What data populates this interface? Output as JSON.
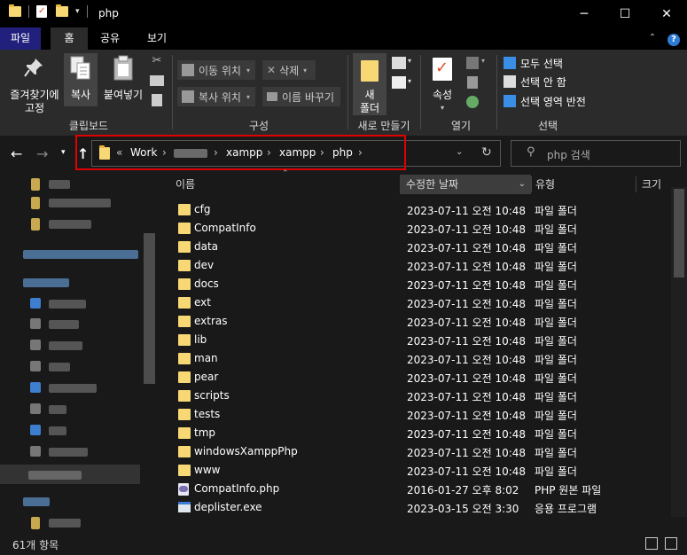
{
  "window": {
    "title": "php",
    "minimize_glyph": "─",
    "maximize_glyph": "☐",
    "close_glyph": "✕"
  },
  "tabs": [
    {
      "label": "파일"
    },
    {
      "label": "홈"
    },
    {
      "label": "공유"
    },
    {
      "label": "보기"
    }
  ],
  "ribbon": {
    "pin_label_1": "즐겨찾기에",
    "pin_label_2": "고정",
    "copy_label": "복사",
    "paste_label": "붙여넣기",
    "clipboard_group": "클립보드",
    "move_to": "이동 위치",
    "copy_to": "복사 위치",
    "delete": "삭제",
    "rename": "이름 바꾸기",
    "organize_group": "구성",
    "new_folder_1": "새",
    "new_folder_2": "폴더",
    "new_group": "새로 만들기",
    "properties": "속성",
    "open_group": "열기",
    "select_all": "모두 선택",
    "select_none": "선택 안 함",
    "invert_selection": "선택 영역 반전",
    "select_group": "선택"
  },
  "address": {
    "overflow": "«",
    "crumbs": [
      "Work",
      "xampp",
      "xampp",
      "php"
    ],
    "search_placeholder": "php 검색"
  },
  "columns": {
    "name": "이름",
    "modified": "수정한 날짜",
    "type": "유형",
    "size": "크기"
  },
  "files": [
    {
      "name": "cfg",
      "date": "2023-07-11 오전 10:48",
      "type": "파일 폴더",
      "kind": "folder"
    },
    {
      "name": "CompatInfo",
      "date": "2023-07-11 오전 10:48",
      "type": "파일 폴더",
      "kind": "folder"
    },
    {
      "name": "data",
      "date": "2023-07-11 오전 10:48",
      "type": "파일 폴더",
      "kind": "folder"
    },
    {
      "name": "dev",
      "date": "2023-07-11 오전 10:48",
      "type": "파일 폴더",
      "kind": "folder"
    },
    {
      "name": "docs",
      "date": "2023-07-11 오전 10:48",
      "type": "파일 폴더",
      "kind": "folder"
    },
    {
      "name": "ext",
      "date": "2023-07-11 오전 10:48",
      "type": "파일 폴더",
      "kind": "folder"
    },
    {
      "name": "extras",
      "date": "2023-07-11 오전 10:48",
      "type": "파일 폴더",
      "kind": "folder"
    },
    {
      "name": "lib",
      "date": "2023-07-11 오전 10:48",
      "type": "파일 폴더",
      "kind": "folder"
    },
    {
      "name": "man",
      "date": "2023-07-11 오전 10:48",
      "type": "파일 폴더",
      "kind": "folder"
    },
    {
      "name": "pear",
      "date": "2023-07-11 오전 10:48",
      "type": "파일 폴더",
      "kind": "folder"
    },
    {
      "name": "scripts",
      "date": "2023-07-11 오전 10:48",
      "type": "파일 폴더",
      "kind": "folder"
    },
    {
      "name": "tests",
      "date": "2023-07-11 오전 10:48",
      "type": "파일 폴더",
      "kind": "folder"
    },
    {
      "name": "tmp",
      "date": "2023-07-11 오전 10:48",
      "type": "파일 폴더",
      "kind": "folder"
    },
    {
      "name": "windowsXamppPhp",
      "date": "2023-07-11 오전 10:48",
      "type": "파일 폴더",
      "kind": "folder"
    },
    {
      "name": "www",
      "date": "2023-07-11 오전 10:48",
      "type": "파일 폴더",
      "kind": "folder"
    },
    {
      "name": "CompatInfo.php",
      "date": "2016-01-27 오후 8:02",
      "type": "PHP 원본 파일",
      "kind": "php"
    },
    {
      "name": "deplister.exe",
      "date": "2023-03-15 오전 3:30",
      "type": "응용 프로그램",
      "kind": "exe"
    }
  ],
  "status": {
    "count": "61개 항목"
  },
  "colors": {
    "accent_file_tab": "#21217d",
    "folder_yellow": "#f8d775",
    "highlight_box": "#e00000"
  }
}
